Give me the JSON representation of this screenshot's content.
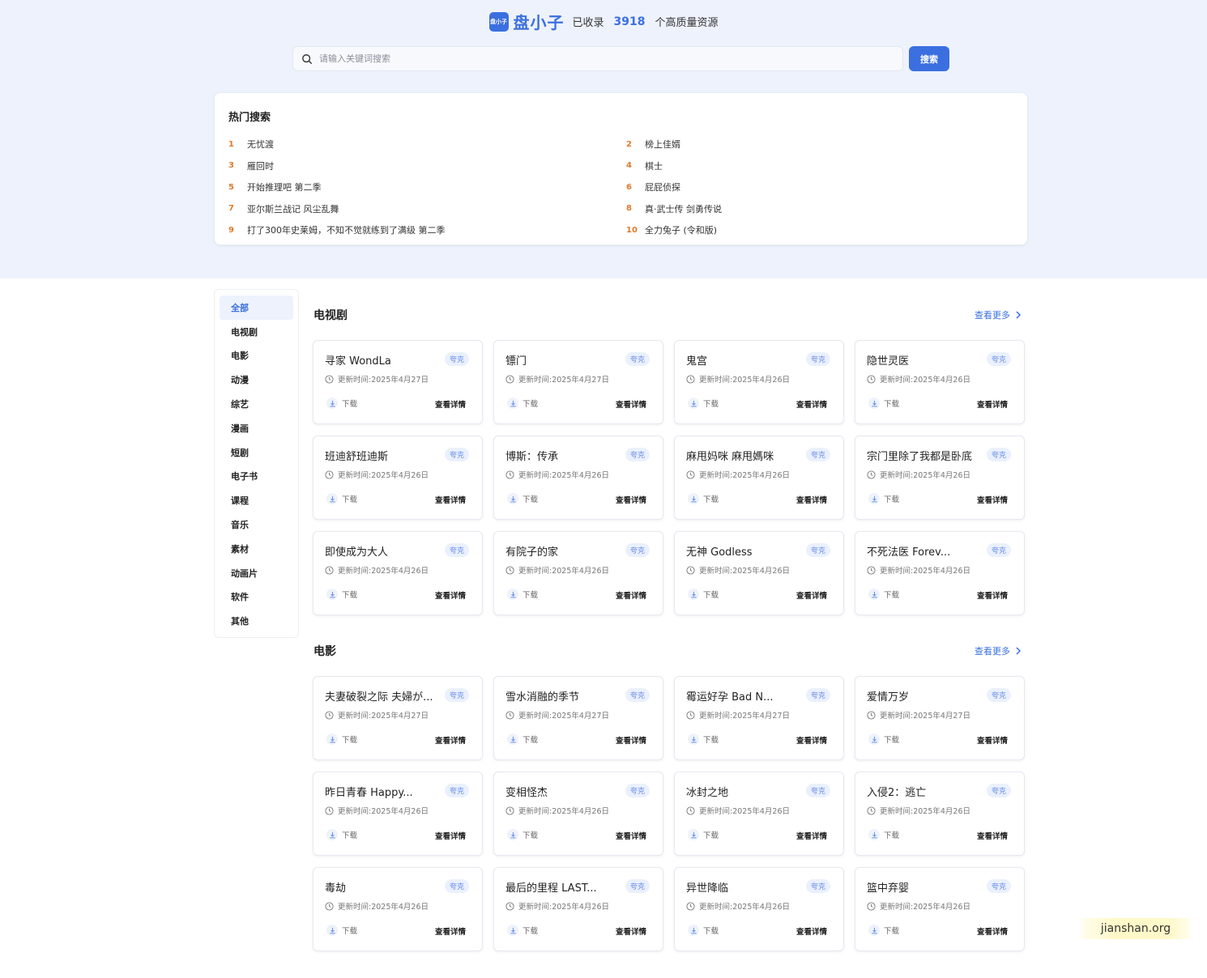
{
  "brand": {
    "logo_text": "盘小子",
    "name": "盘小子",
    "prefix": "已收录",
    "count": "3918",
    "suffix": "个高质量资源"
  },
  "search": {
    "placeholder": "请输入关键词搜索",
    "button_label": "搜索"
  },
  "hot": {
    "title": "热门搜索",
    "left": [
      {
        "rank": "1",
        "text": "无忧渡"
      },
      {
        "rank": "3",
        "text": "雁回时"
      },
      {
        "rank": "5",
        "text": "开始推理吧 第二季"
      },
      {
        "rank": "7",
        "text": "亚尔斯兰战记 风尘乱舞"
      },
      {
        "rank": "9",
        "text": "打了300年史莱姆，不知不觉就练到了满级 第二季"
      }
    ],
    "right": [
      {
        "rank": "2",
        "text": "榜上佳婿"
      },
      {
        "rank": "4",
        "text": "棋士"
      },
      {
        "rank": "6",
        "text": "屁屁侦探"
      },
      {
        "rank": "8",
        "text": "真·武士传 剑勇传说"
      },
      {
        "rank": "10",
        "text": "全力兔子 (令和版)"
      }
    ]
  },
  "sidebar": {
    "items": [
      "全部",
      "电视剧",
      "电影",
      "动漫",
      "综艺",
      "漫画",
      "短剧",
      "电子书",
      "课程",
      "音乐",
      "素材",
      "动画片",
      "软件",
      "其他"
    ],
    "active_index": 0
  },
  "card_labels": {
    "badge": "夸克",
    "time_prefix": "更新时间: ",
    "download": "下载",
    "detail": "查看详情"
  },
  "sections": [
    {
      "title": "电视剧",
      "more": "查看更多",
      "cards": [
        {
          "title": "寻家 WondLa",
          "date": "2025年4月27日"
        },
        {
          "title": "镖门",
          "date": "2025年4月27日"
        },
        {
          "title": "鬼宫",
          "date": "2025年4月26日"
        },
        {
          "title": "隐世灵医",
          "date": "2025年4月26日"
        },
        {
          "title": "班迪舒班迪斯",
          "date": "2025年4月26日"
        },
        {
          "title": "博斯：传承",
          "date": "2025年4月26日"
        },
        {
          "title": "麻甩妈咪 麻甩媽咪",
          "date": "2025年4月26日"
        },
        {
          "title": "宗门里除了我都是卧底",
          "date": "2025年4月26日"
        },
        {
          "title": "即使成为大人",
          "date": "2025年4月26日"
        },
        {
          "title": "有院子的家",
          "date": "2025年4月26日"
        },
        {
          "title": "无神 Godless",
          "date": "2025年4月26日"
        },
        {
          "title": "不死法医 Forev...",
          "date": "2025年4月26日"
        }
      ]
    },
    {
      "title": "电影",
      "more": "查看更多",
      "cards": [
        {
          "title": "夫妻破裂之际 夫婦が...",
          "date": "2025年4月27日"
        },
        {
          "title": "雪水消融的季节",
          "date": "2025年4月27日"
        },
        {
          "title": "霉运好孕 Bad N...",
          "date": "2025年4月27日"
        },
        {
          "title": "爱情万岁",
          "date": "2025年4月27日"
        },
        {
          "title": "昨日青春 Happy...",
          "date": "2025年4月26日"
        },
        {
          "title": "变相怪杰",
          "date": "2025年4月26日"
        },
        {
          "title": "冰封之地",
          "date": "2025年4月26日"
        },
        {
          "title": "入侵2：逃亡",
          "date": "2025年4月26日"
        },
        {
          "title": "毒劫",
          "date": "2025年4月26日"
        },
        {
          "title": "最后的里程 LAST...",
          "date": "2025年4月26日"
        },
        {
          "title": "异世降临",
          "date": "2025年4月26日"
        },
        {
          "title": "篮中弃婴",
          "date": "2025年4月26日"
        }
      ]
    }
  ],
  "watermark": "jianshan.org"
}
